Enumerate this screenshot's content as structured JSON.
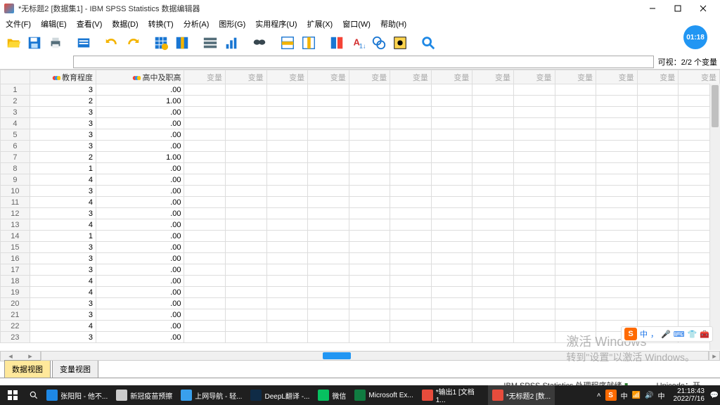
{
  "title": "*无标题2 [数据集1] - IBM SPSS Statistics 数据编辑器",
  "menus": [
    "文件(F)",
    "编辑(E)",
    "查看(V)",
    "数据(D)",
    "转换(T)",
    "分析(A)",
    "图形(G)",
    "实用程序(U)",
    "扩展(X)",
    "窗口(W)",
    "帮助(H)"
  ],
  "clock_badge": "01:18",
  "visible_label": "可视：2/2 个变量",
  "columns": {
    "edu": "教育程度",
    "hs": "高中及职高",
    "empty": "变量"
  },
  "rows": [
    {
      "n": 1,
      "edu": "3",
      "hs": ".00"
    },
    {
      "n": 2,
      "edu": "2",
      "hs": "1.00"
    },
    {
      "n": 3,
      "edu": "3",
      "hs": ".00"
    },
    {
      "n": 4,
      "edu": "3",
      "hs": ".00"
    },
    {
      "n": 5,
      "edu": "3",
      "hs": ".00"
    },
    {
      "n": 6,
      "edu": "3",
      "hs": ".00"
    },
    {
      "n": 7,
      "edu": "2",
      "hs": "1.00"
    },
    {
      "n": 8,
      "edu": "1",
      "hs": ".00"
    },
    {
      "n": 9,
      "edu": "4",
      "hs": ".00"
    },
    {
      "n": 10,
      "edu": "3",
      "hs": ".00"
    },
    {
      "n": 11,
      "edu": "4",
      "hs": ".00"
    },
    {
      "n": 12,
      "edu": "3",
      "hs": ".00"
    },
    {
      "n": 13,
      "edu": "4",
      "hs": ".00"
    },
    {
      "n": 14,
      "edu": "1",
      "hs": ".00"
    },
    {
      "n": 15,
      "edu": "3",
      "hs": ".00"
    },
    {
      "n": 16,
      "edu": "3",
      "hs": ".00"
    },
    {
      "n": 17,
      "edu": "3",
      "hs": ".00"
    },
    {
      "n": 18,
      "edu": "4",
      "hs": ".00"
    },
    {
      "n": 19,
      "edu": "4",
      "hs": ".00"
    },
    {
      "n": 20,
      "edu": "3",
      "hs": ".00"
    },
    {
      "n": 21,
      "edu": "3",
      "hs": ".00"
    },
    {
      "n": 22,
      "edu": "4",
      "hs": ".00"
    },
    {
      "n": 23,
      "edu": "3",
      "hs": ".00"
    }
  ],
  "tabs": {
    "data": "数据视图",
    "var": "变量视图"
  },
  "status": {
    "proc": "IBM SPSS Statistics 处理程序就绪",
    "unicode": "Unicode：开"
  },
  "watermark": {
    "line1": "激活 Windows",
    "line2": "转到\"设置\"以激活 Windows。"
  },
  "ime": {
    "logo": "S",
    "text": "中"
  },
  "taskbar": {
    "items": [
      {
        "label": "张阳阳 - 他不...",
        "color": "#1e88e5"
      },
      {
        "label": "新冠疫苗预擦",
        "color": "#ccc"
      },
      {
        "label": "上网导航 - 轻...",
        "color": "#39a0ed"
      },
      {
        "label": "DeepL翻译 -...",
        "color": "#0f2b46"
      },
      {
        "label": "微信",
        "color": "#07c160"
      },
      {
        "label": "Microsoft Ex...",
        "color": "#107c41"
      },
      {
        "label": "*输出1 [文档1...",
        "color": "#e74c3c"
      },
      {
        "label": "*无标题2 [数...",
        "color": "#e74c3c",
        "active": true
      }
    ],
    "tray_s": "S",
    "time": "21:18:43",
    "date": "2022/7/16"
  }
}
